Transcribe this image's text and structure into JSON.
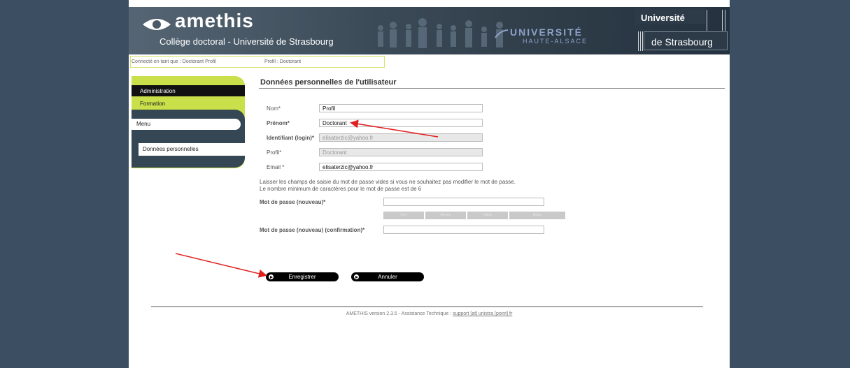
{
  "header": {
    "app_name": "amethis",
    "subtitle": "Collège doctoral - Université de Strasbourg",
    "uha_line1": "UNIVERSITÉ",
    "uha_line2": "HAUTE-ALSACE",
    "unistra_top": "Université",
    "unistra_bottom": "de Strasbourg"
  },
  "status": {
    "connected": "Connecté en tant que : Doctorant Profil",
    "profile": "Profil : Doctorant"
  },
  "sidebar": {
    "administration": "Administration",
    "formation": "Formation",
    "menu": "Menu",
    "item": "Données personnelles"
  },
  "form": {
    "title": "Données personnelles de l'utilisateur",
    "nom_label": "Nom*",
    "nom_value": "Profil",
    "prenom_label": "Prénom*",
    "prenom_value": "Doctorant",
    "login_label": "Identifiant (login)*",
    "login_value": "elisaterzic@yahoo.fr",
    "profil_label": "Profil*",
    "profil_value": "Doctorant",
    "email_label": "Email *",
    "email_value": "elisaterzic@yahoo.fr",
    "pw_note_1": "Laisser les champs de saisie du mot de passe vides si vous ne souhaitez pas modifier le mot de passe.",
    "pw_note_2": "Le nombre minimum de caractères pour le mot de passe est de 6",
    "pw_new_label": "Mot de passe (nouveau)*",
    "pw_confirm_label": "Mot de passe (nouveau) (confirmation)*",
    "strength": [
      "Fort",
      "Moyen",
      "Faible",
      "Refus"
    ],
    "save_label": "Enregistrer",
    "cancel_label": "Annuler"
  },
  "footer": {
    "text": "AMETHIS version 2.3.5 - Assistance Technique : ",
    "link": "support [at] unistra [point] fr"
  },
  "colors": {
    "background": "#3c4f62",
    "sidebar_lime": "#c9e04a",
    "sidebar_dark": "#354754",
    "annotation_red": "#e02020"
  }
}
